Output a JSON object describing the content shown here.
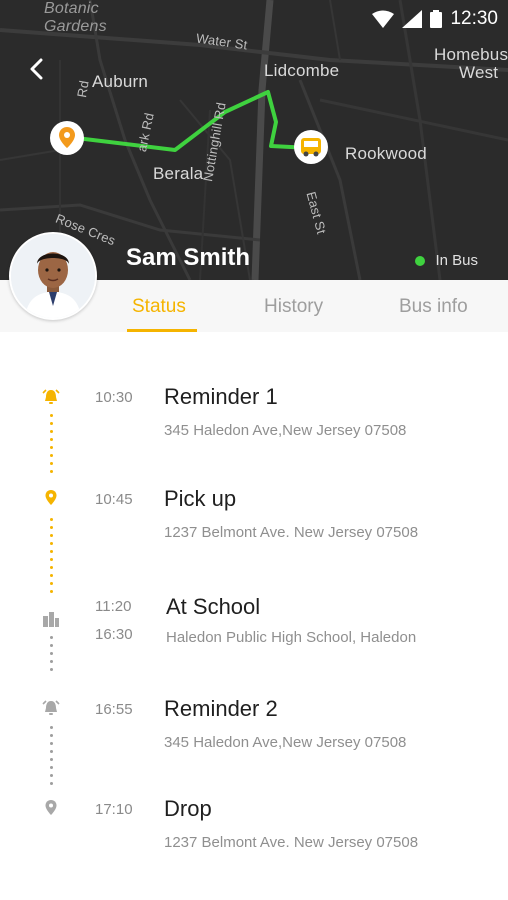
{
  "status_bar": {
    "time": "12:30"
  },
  "map": {
    "labels": {
      "botanic": "Botanic",
      "gardens": "Gardens",
      "water_st": "Water St",
      "auburn": "Auburn",
      "lidcombe": "Lidcombe",
      "homebush": "Homebus",
      "west": "West",
      "berala": "Berala",
      "rookwood": "Rookwood",
      "nottinghill": "Nottinghill Rd",
      "east_st": "East St",
      "rose_cres": "Rose Cres",
      "park_rd": "ark Rd",
      "s_rd": "Rd"
    },
    "route_color": "#3fd23f"
  },
  "student": {
    "name": "Sam Smith",
    "status": "In Bus"
  },
  "tabs": [
    {
      "label": "Status",
      "active": true
    },
    {
      "label": "History",
      "active": false
    },
    {
      "label": "Bus info",
      "active": false
    }
  ],
  "timeline": [
    {
      "icon": "alarm-icon",
      "times": [
        "10:30"
      ],
      "title": "Reminder 1",
      "address": "345 Haledon Ave,New Jersey 07508",
      "completed": true
    },
    {
      "icon": "location-pin-icon",
      "times": [
        "10:45"
      ],
      "title": "Pick up",
      "address": "1237 Belmont Ave. New Jersey 07508",
      "completed": true
    },
    {
      "icon": "school-building-icon",
      "times": [
        "11:20",
        "16:30"
      ],
      "title": "At School",
      "address": "Haledon Public High School, Haledon",
      "completed": false
    },
    {
      "icon": "alarm-icon",
      "times": [
        "16:55"
      ],
      "title": "Reminder 2",
      "address": "345 Haledon Ave,New Jersey 07508",
      "completed": false
    },
    {
      "icon": "location-pin-icon",
      "times": [
        "17:10"
      ],
      "title": "Drop",
      "address": "1237 Belmont Ave. New Jersey 07508",
      "completed": false
    }
  ],
  "colors": {
    "accent": "#f5b400",
    "inactive": "#9e9e9e",
    "online": "#3fd23f"
  }
}
